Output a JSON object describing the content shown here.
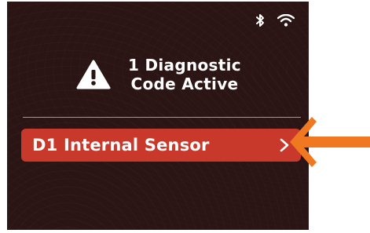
{
  "alert": {
    "line1": "1 Diagnostic",
    "line2": "Code Active"
  },
  "diagnostic_code": {
    "label": "D1 Internal Sensor"
  },
  "icons": {
    "status": [
      "bluetooth-icon",
      "wifi-icon"
    ],
    "alert": "warning-icon",
    "row": "chevron-right-icon",
    "annotation": "orange-arrow-icon"
  },
  "colors": {
    "screen_bg": "#2a1414",
    "code_row": "#c8392c",
    "annotation_arrow": "#f07820"
  }
}
